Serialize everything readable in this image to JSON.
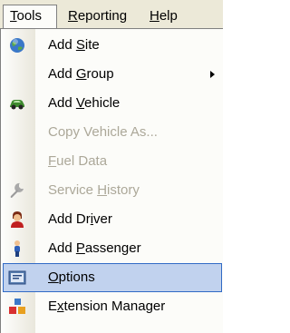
{
  "menubar": [
    {
      "label": "Tools",
      "accelerator_index": 0,
      "open": true
    },
    {
      "label": "Reporting",
      "accelerator_index": 0,
      "open": false
    },
    {
      "label": "Help",
      "accelerator_index": 0,
      "open": false
    }
  ],
  "menu": {
    "items": [
      {
        "label": "Add Site",
        "accelerator_index": 4,
        "enabled": true,
        "highlighted": false,
        "submenu": false,
        "icon": "globe-icon"
      },
      {
        "label": "Add Group",
        "accelerator_index": 4,
        "enabled": true,
        "highlighted": false,
        "submenu": true,
        "icon": ""
      },
      {
        "label": "Add Vehicle",
        "accelerator_index": 4,
        "enabled": true,
        "highlighted": false,
        "submenu": false,
        "icon": "car-icon"
      },
      {
        "label": "Copy Vehicle As...",
        "accelerator_index": -1,
        "enabled": false,
        "highlighted": false,
        "submenu": false,
        "icon": ""
      },
      {
        "label": "Fuel Data",
        "accelerator_index": 0,
        "enabled": false,
        "highlighted": false,
        "submenu": false,
        "icon": ""
      },
      {
        "label": "Service History",
        "accelerator_index": 8,
        "enabled": false,
        "highlighted": false,
        "submenu": false,
        "icon": "wrench-icon"
      },
      {
        "label": "Add Driver",
        "accelerator_index": 6,
        "enabled": true,
        "highlighted": false,
        "submenu": false,
        "icon": "driver-icon"
      },
      {
        "label": "Add Passenger",
        "accelerator_index": 4,
        "enabled": true,
        "highlighted": false,
        "submenu": false,
        "icon": "passenger-icon"
      },
      {
        "label": "Options",
        "accelerator_index": 0,
        "enabled": true,
        "highlighted": true,
        "submenu": false,
        "icon": "options-icon"
      },
      {
        "label": "Extension Manager",
        "accelerator_index": 1,
        "enabled": true,
        "highlighted": false,
        "submenu": false,
        "icon": "extensions-icon"
      }
    ]
  },
  "colors": {
    "menubar_bg": "#ece9d8",
    "menu_bg": "#fcfcf9",
    "highlight_bg": "#c1d2ee",
    "highlight_border": "#316ac5",
    "disabled_text": "#aca899"
  }
}
